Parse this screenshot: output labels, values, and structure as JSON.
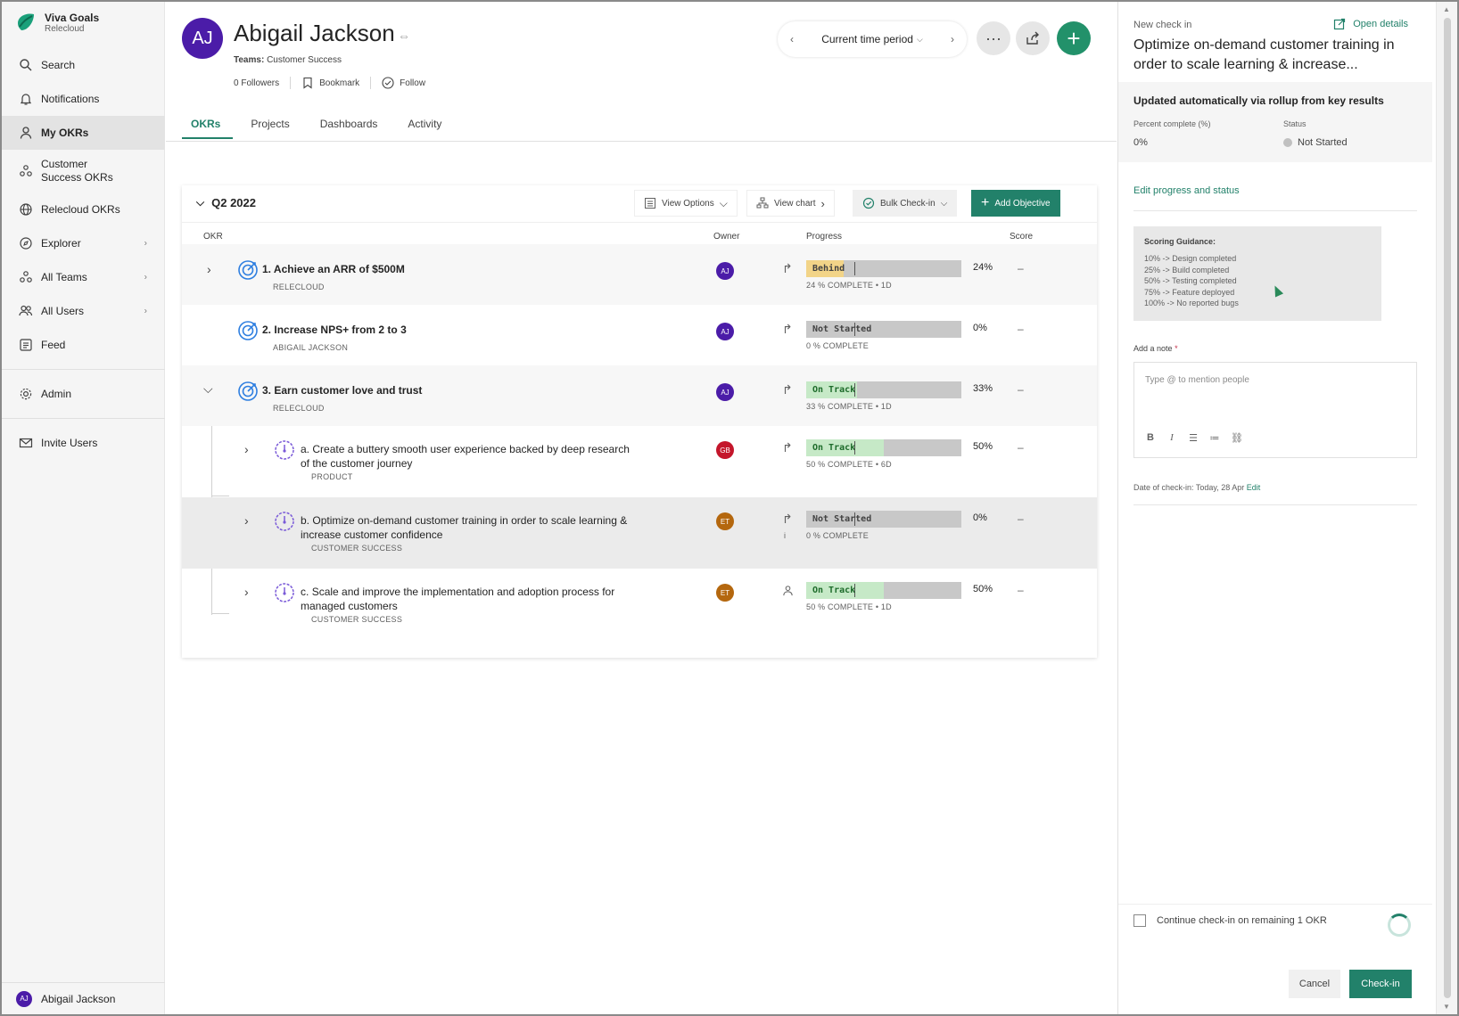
{
  "app": {
    "name": "Viva Goals",
    "org": "Relecloud"
  },
  "sidebar": {
    "items": [
      {
        "label": "Search",
        "icon": "search-icon"
      },
      {
        "label": "Notifications",
        "icon": "bell-icon"
      },
      {
        "label": "My OKRs",
        "icon": "person-icon",
        "active": true
      },
      {
        "label": "Customer Success OKRs",
        "icon": "team-icon"
      },
      {
        "label": "Relecloud OKRs",
        "icon": "globe-icon"
      },
      {
        "label": "Explorer",
        "icon": "compass-icon"
      },
      {
        "label": "All Teams",
        "icon": "teams-icon"
      },
      {
        "label": "All Users",
        "icon": "users-icon"
      },
      {
        "label": "Feed",
        "icon": "feed-icon"
      },
      {
        "label": "Admin",
        "icon": "gear-icon"
      },
      {
        "label": "Invite Users",
        "icon": "mail-icon"
      }
    ],
    "user": {
      "initials": "AJ",
      "name": "Abigail Jackson"
    }
  },
  "profile": {
    "initials": "AJ",
    "name": "Abigail Jackson",
    "teams_label": "Teams:",
    "teams_value": "Customer Success",
    "followers": "0 Followers",
    "bookmark": "Bookmark",
    "follow": "Follow"
  },
  "period": {
    "label": "Current time period"
  },
  "tabs": [
    "OKRs",
    "Projects",
    "Dashboards",
    "Activity"
  ],
  "okr_panel": {
    "quarter": "Q2 2022",
    "view_options": "View Options",
    "view_chart": "View chart",
    "bulk_checkin": "Bulk Check-in",
    "add_objective": "Add Objective",
    "columns": {
      "okr": "OKR",
      "owner": "Owner",
      "progress": "Progress",
      "score": "Score"
    },
    "rows": [
      {
        "num": "1.",
        "title": "Achieve an ARR of $500M",
        "sub": "RELECLOUD",
        "owner": "AJ",
        "owner_color": "#4b1ca8",
        "status": "Behind",
        "status_color": "#f2d488",
        "progress": 24,
        "pct": "24%",
        "meta": "24 % COMPLETE • 1D",
        "score": "–"
      },
      {
        "num": "2.",
        "title": "Increase NPS+ from 2 to 3",
        "sub": "ABIGAIL JACKSON",
        "owner": "AJ",
        "owner_color": "#4b1ca8",
        "status": "Not Started",
        "status_color": "#c8c8c8",
        "progress": 0,
        "pct": "0%",
        "meta": "0 % COMPLETE",
        "score": "–"
      },
      {
        "num": "3.",
        "title": "Earn customer love and trust",
        "sub": "RELECLOUD",
        "owner": "AJ",
        "owner_color": "#4b1ca8",
        "status": "On Track",
        "status_color": "#c6e9c7",
        "progress": 33,
        "pct": "33%",
        "meta": "33 % COMPLETE • 1D",
        "score": "–"
      },
      {
        "num": "a.",
        "title": "Create a buttery smooth user experience backed by deep research of the customer journey",
        "sub": "PRODUCT",
        "owner": "GB",
        "owner_color": "#c4162b",
        "status": "On Track",
        "status_color": "#c6e9c7",
        "progress": 50,
        "pct": "50%",
        "meta": "50 % COMPLETE • 6D",
        "score": "–"
      },
      {
        "num": "b.",
        "title": "Optimize on-demand customer training in order to scale learning & increase customer confidence",
        "sub": "CUSTOMER SUCCESS",
        "owner": "ET",
        "owner_color": "#b4670e",
        "status": "Not Started",
        "status_color": "#c8c8c8",
        "progress": 0,
        "pct": "0%",
        "meta": "0 % COMPLETE",
        "score": "–"
      },
      {
        "num": "c.",
        "title": "Scale and improve the implementation and adoption process for managed customers",
        "sub": "CUSTOMER SUCCESS",
        "owner": "ET",
        "owner_color": "#b4670e",
        "status": "On Track",
        "status_color": "#c6e9c7",
        "progress": 50,
        "pct": "50%",
        "meta": "50 % COMPLETE • 1D",
        "score": "–"
      }
    ]
  },
  "checkin": {
    "small": "New check in",
    "open_details": "Open details",
    "title": "Optimize on-demand customer training in order to scale learning & increase...",
    "rollup": "Updated automatically via rollup from key results",
    "percent_label": "Percent complete (%)",
    "percent_value": "0%",
    "status_label": "Status",
    "status_value": "Not Started",
    "edit_progress": "Edit progress and status",
    "guidance_title": "Scoring Guidance:",
    "guidance": [
      "10% -> Design completed",
      "25% -> Build completed",
      "50% -> Testing completed",
      "75% -> Feature deployed",
      "100% -> No reported bugs"
    ],
    "note_label": "Add a note",
    "note_placeholder": "Type @ to mention people",
    "date_line": "Date of check-in: Today, 28 Apr",
    "date_edit": "Edit",
    "continue": "Continue check-in on remaining 1 OKR",
    "cancel": "Cancel",
    "checkin": "Check-in"
  }
}
